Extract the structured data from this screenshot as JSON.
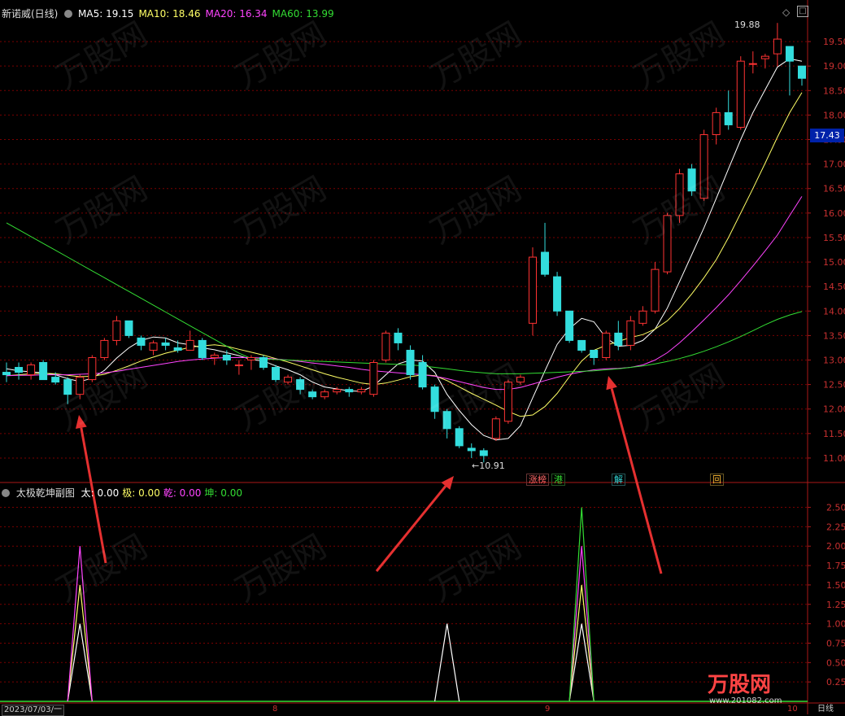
{
  "stock": {
    "title": "新诺威(日线)",
    "ma_labels": [
      {
        "label": "MA5: 19.15",
        "color": "#ffffff"
      },
      {
        "label": "MA10: 18.46",
        "color": "#ffff66"
      },
      {
        "label": "MA20: 16.34",
        "color": "#ff44ff"
      },
      {
        "label": "MA60: 13.99",
        "color": "#33dd33"
      }
    ],
    "current_price": "17.43",
    "high_label": "19.88",
    "low_label": "10.91",
    "tags": [
      {
        "text": "涨榜",
        "color": "#ff6666"
      },
      {
        "text": "港",
        "color": "#33dd33"
      },
      {
        "text": "解",
        "color": "#33dddd"
      },
      {
        "text": "回",
        "color": "#ffbb33"
      }
    ]
  },
  "indicator": {
    "title": "太极乾坤副图",
    "items": [
      {
        "label": "太: 0.00",
        "color": "#ffffff"
      },
      {
        "label": "极: 0.00",
        "color": "#ffff66"
      },
      {
        "label": "乾: 0.00",
        "color": "#ff44ff"
      },
      {
        "label": "坤: 0.00",
        "color": "#33dd33"
      }
    ]
  },
  "footer": {
    "date_label": "2023/07/03/一",
    "month_labels": [
      "8",
      "9",
      "10"
    ],
    "period_label": "日线"
  },
  "watermark": "万股网 www.201082.com",
  "colors": {
    "up": "#ff3333",
    "down": "#33dddd",
    "grid": "#7a0000",
    "axis": "#aa1818",
    "arrow": "#e53030"
  },
  "chart_data": [
    {
      "type": "candlestick",
      "title": "新诺威(日线)",
      "ylim": [
        10.75,
        19.85
      ],
      "y_ticks": [
        11.0,
        11.5,
        12.0,
        12.5,
        13.0,
        13.5,
        14.0,
        14.5,
        15.0,
        15.5,
        16.0,
        16.5,
        17.0,
        17.5,
        18.0,
        18.5,
        19.0,
        19.5
      ],
      "grid": true,
      "candles": [
        [
          12.75,
          12.95,
          12.55,
          12.7
        ],
        [
          12.85,
          12.95,
          12.6,
          12.75
        ],
        [
          12.7,
          12.95,
          12.6,
          12.9
        ],
        [
          12.95,
          13.0,
          12.6,
          12.6
        ],
        [
          12.65,
          12.75,
          12.5,
          12.55
        ],
        [
          12.6,
          12.65,
          12.1,
          12.3
        ],
        [
          12.3,
          12.7,
          12.2,
          12.65
        ],
        [
          12.6,
          13.1,
          12.55,
          13.05
        ],
        [
          13.05,
          13.45,
          13.0,
          13.4
        ],
        [
          13.4,
          13.9,
          13.3,
          13.8
        ],
        [
          13.8,
          13.8,
          13.45,
          13.5
        ],
        [
          13.45,
          13.5,
          13.2,
          13.3
        ],
        [
          13.2,
          13.4,
          13.1,
          13.35
        ],
        [
          13.35,
          13.45,
          13.2,
          13.3
        ],
        [
          13.25,
          13.4,
          13.15,
          13.2
        ],
        [
          13.2,
          13.6,
          13.2,
          13.4
        ],
        [
          13.4,
          13.45,
          13.0,
          13.05
        ],
        [
          13.05,
          13.15,
          12.9,
          13.1
        ],
        [
          13.1,
          13.2,
          12.9,
          13.0
        ],
        [
          12.9,
          13.0,
          12.7,
          12.9
        ],
        [
          13.0,
          13.1,
          12.8,
          13.05
        ],
        [
          13.05,
          13.1,
          12.8,
          12.85
        ],
        [
          12.85,
          12.9,
          12.55,
          12.6
        ],
        [
          12.55,
          12.7,
          12.5,
          12.65
        ],
        [
          12.6,
          12.65,
          12.3,
          12.4
        ],
        [
          12.35,
          12.4,
          12.2,
          12.25
        ],
        [
          12.25,
          12.4,
          12.2,
          12.35
        ],
        [
          12.35,
          12.45,
          12.3,
          12.4
        ],
        [
          12.4,
          12.45,
          12.25,
          12.35
        ],
        [
          12.35,
          12.45,
          12.3,
          12.4
        ],
        [
          12.3,
          13.0,
          12.25,
          12.95
        ],
        [
          13.0,
          13.6,
          12.95,
          13.55
        ],
        [
          13.55,
          13.65,
          13.2,
          13.35
        ],
        [
          13.2,
          13.3,
          12.6,
          12.7
        ],
        [
          12.95,
          13.1,
          12.4,
          12.45
        ],
        [
          12.45,
          12.5,
          11.8,
          11.95
        ],
        [
          11.95,
          12.0,
          11.4,
          11.6
        ],
        [
          11.6,
          11.65,
          11.2,
          11.25
        ],
        [
          11.2,
          11.3,
          11.0,
          11.15
        ],
        [
          11.15,
          11.2,
          10.91,
          11.05
        ],
        [
          11.4,
          11.85,
          11.35,
          11.8
        ],
        [
          11.75,
          12.6,
          11.7,
          12.55
        ],
        [
          12.55,
          12.7,
          12.5,
          12.65
        ],
        [
          13.75,
          15.3,
          13.5,
          15.1
        ],
        [
          15.2,
          15.8,
          14.7,
          14.75
        ],
        [
          14.7,
          14.8,
          13.9,
          14.0
        ],
        [
          14.0,
          14.0,
          13.35,
          13.4
        ],
        [
          13.4,
          13.4,
          13.15,
          13.2
        ],
        [
          13.2,
          13.15,
          12.9,
          13.05
        ],
        [
          13.05,
          13.6,
          13.0,
          13.55
        ],
        [
          13.55,
          13.8,
          13.2,
          13.3
        ],
        [
          13.3,
          13.9,
          13.2,
          13.8
        ],
        [
          13.75,
          14.1,
          13.7,
          14.0
        ],
        [
          14.0,
          15.0,
          13.95,
          14.85
        ],
        [
          14.8,
          16.0,
          14.75,
          15.95
        ],
        [
          15.95,
          16.9,
          15.8,
          16.8
        ],
        [
          16.9,
          17.0,
          16.35,
          16.45
        ],
        [
          16.3,
          17.7,
          16.25,
          17.6
        ],
        [
          17.6,
          18.15,
          17.4,
          18.05
        ],
        [
          18.05,
          18.5,
          17.7,
          17.8
        ],
        [
          17.75,
          19.2,
          17.7,
          19.1
        ],
        [
          19.05,
          19.3,
          18.85,
          19.05
        ],
        [
          19.15,
          19.25,
          18.95,
          19.2
        ],
        [
          19.25,
          19.88,
          19.0,
          19.55
        ],
        [
          19.4,
          19.4,
          18.4,
          19.1
        ],
        [
          19.0,
          19.0,
          18.6,
          18.75
        ]
      ],
      "series": [
        {
          "name": "MA5",
          "color": "#ffffff",
          "values": [
            12.82,
            12.78,
            12.76,
            12.74,
            12.7,
            12.62,
            12.56,
            12.63,
            12.79,
            13.04,
            13.25,
            13.4,
            13.47,
            13.45,
            13.35,
            13.31,
            13.25,
            13.21,
            13.15,
            13.09,
            13.01,
            12.98,
            12.88,
            12.8,
            12.7,
            12.55,
            12.45,
            12.41,
            12.37,
            12.36,
            12.47,
            12.7,
            12.92,
            13.0,
            12.98,
            12.75,
            12.3,
            11.97,
            11.68,
            11.46,
            11.37,
            11.4,
            11.66,
            12.23,
            12.78,
            13.32,
            13.64,
            13.85,
            13.78,
            13.45,
            13.28,
            13.3,
            13.4,
            13.63,
            14.06,
            14.6,
            15.15,
            15.7,
            16.3,
            16.9,
            17.5,
            18.05,
            18.52,
            18.98,
            19.15,
            19.1
          ]
        },
        {
          "name": "MA10",
          "color": "#ffff66",
          "values": [
            12.68,
            12.7,
            12.72,
            12.73,
            12.72,
            12.69,
            12.66,
            12.67,
            12.71,
            12.79,
            12.88,
            12.98,
            13.06,
            13.14,
            13.2,
            13.26,
            13.29,
            13.31,
            13.28,
            13.22,
            13.16,
            13.1,
            13.03,
            12.96,
            12.88,
            12.8,
            12.72,
            12.65,
            12.59,
            12.53,
            12.5,
            12.53,
            12.59,
            12.66,
            12.7,
            12.68,
            12.58,
            12.45,
            12.32,
            12.2,
            12.08,
            11.95,
            11.85,
            11.88,
            12.05,
            12.32,
            12.66,
            12.98,
            13.2,
            13.3,
            13.38,
            13.46,
            13.52,
            13.63,
            13.8,
            14.05,
            14.35,
            14.68,
            15.05,
            15.5,
            16.0,
            16.5,
            17.02,
            17.55,
            18.05,
            18.46
          ]
        },
        {
          "name": "MA20",
          "color": "#ff44ff",
          "values": [
            12.68,
            12.69,
            12.69,
            12.7,
            12.7,
            12.7,
            12.71,
            12.72,
            12.74,
            12.77,
            12.81,
            12.85,
            12.89,
            12.93,
            12.97,
            13.0,
            13.02,
            13.04,
            13.05,
            13.05,
            13.05,
            13.04,
            13.02,
            13.0,
            12.97,
            12.94,
            12.91,
            12.88,
            12.85,
            12.81,
            12.78,
            12.76,
            12.74,
            12.72,
            12.7,
            12.67,
            12.62,
            12.56,
            12.5,
            12.44,
            12.4,
            12.4,
            12.44,
            12.51,
            12.58,
            12.65,
            12.71,
            12.76,
            12.8,
            12.82,
            12.83,
            12.85,
            12.9,
            13.0,
            13.15,
            13.35,
            13.58,
            13.82,
            14.07,
            14.33,
            14.62,
            14.92,
            15.23,
            15.55,
            15.95,
            16.34
          ]
        },
        {
          "name": "MA60",
          "color": "#33dd33",
          "values": [
            15.8,
            15.66,
            15.52,
            15.38,
            15.24,
            15.1,
            14.96,
            14.82,
            14.68,
            14.54,
            14.4,
            14.26,
            14.12,
            13.98,
            13.84,
            13.7,
            13.56,
            13.42,
            13.28,
            13.14,
            13.03,
            13.02,
            13.01,
            13.0,
            12.99,
            12.98,
            12.97,
            12.96,
            12.95,
            12.94,
            12.93,
            12.92,
            12.91,
            12.9,
            12.88,
            12.85,
            12.82,
            12.79,
            12.76,
            12.74,
            12.72,
            12.72,
            12.72,
            12.73,
            12.74,
            12.75,
            12.76,
            12.77,
            12.78,
            12.8,
            12.82,
            12.85,
            12.88,
            12.92,
            12.97,
            13.03,
            13.1,
            13.18,
            13.27,
            13.37,
            13.48,
            13.6,
            13.72,
            13.83,
            13.92,
            13.99
          ]
        }
      ]
    },
    {
      "type": "line",
      "title": "太极乾坤副图",
      "ylim": [
        0,
        2.6
      ],
      "y_ticks": [
        0.25,
        0.5,
        0.75,
        1.0,
        1.25,
        1.5,
        1.75,
        2.0,
        2.25,
        2.5
      ],
      "series": [
        {
          "name": "太",
          "color": "#ffffff",
          "peaks": [
            [
              6,
              1.0
            ],
            [
              36,
              1.0
            ],
            [
              47,
              1.0
            ]
          ]
        },
        {
          "name": "极",
          "color": "#ffff66",
          "peaks": [
            [
              6,
              1.5
            ],
            [
              47,
              1.5
            ]
          ]
        },
        {
          "name": "乾",
          "color": "#ff44ff",
          "peaks": [
            [
              6,
              2.0
            ],
            [
              47,
              2.0
            ]
          ]
        },
        {
          "name": "坤",
          "color": "#33dd33",
          "peaks": [
            [
              47,
              2.5
            ]
          ]
        }
      ]
    }
  ]
}
